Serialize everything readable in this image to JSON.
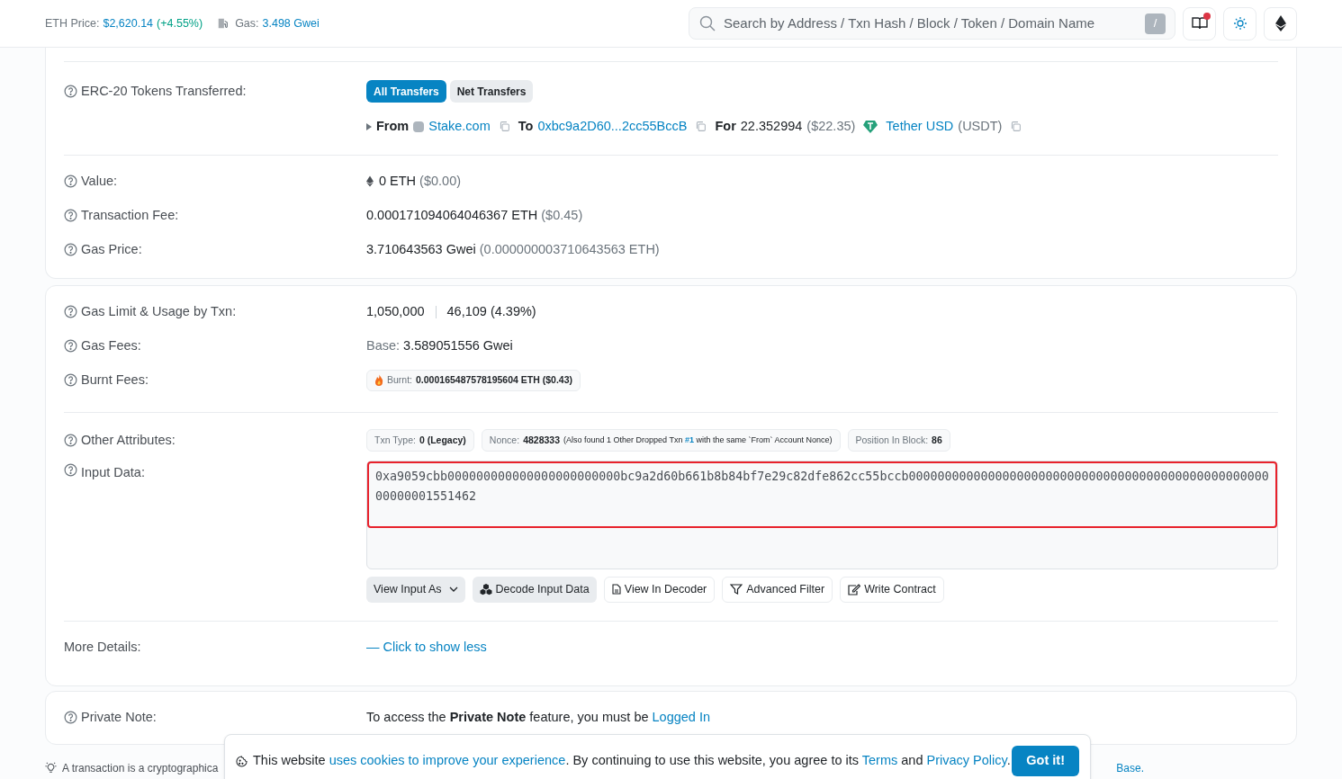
{
  "header": {
    "eth_price_label": "ETH Price:",
    "eth_price": "$2,620.14",
    "eth_change": "(+4.55%)",
    "gas_label": "Gas:",
    "gas_value": "3.498 Gwei",
    "search": {
      "placeholder": "Search by Address / Txn Hash / Block / Token / Domain Name",
      "shortcut": "/"
    },
    "notification": true
  },
  "tokens_row": {
    "label": "ERC-20 Tokens Transferred:",
    "tabs": [
      {
        "label": "All Transfers",
        "selected": true
      },
      {
        "label": "Net Transfers",
        "selected": false
      }
    ],
    "transfer": {
      "from_label": "From",
      "from": "Stake.com",
      "to_label": "To",
      "to": "0xbc9a2D60...2cc55BccB",
      "for_label": "For",
      "amount": "22.352994",
      "usd": "($22.35)",
      "token": "Tether USD",
      "symbol": "(USDT)"
    }
  },
  "summary_rows": [
    {
      "label": "Value:",
      "value": "0 ETH",
      "extra": "($0.00)",
      "kind": "eth"
    },
    {
      "label": "Transaction Fee:",
      "value": "0.000171094064046367 ETH",
      "extra": "($0.45)",
      "kind": "plain"
    },
    {
      "label": "Gas Price:",
      "value": "3.710643563 Gwei",
      "extra": "(0.000000003710643563 ETH)",
      "kind": "plain"
    }
  ],
  "gas_rows": [
    {
      "label": "Gas Limit & Usage by Txn:",
      "limit": "1,050,000",
      "usage": "46,109 (4.39%)"
    },
    {
      "label": "Gas Fees:",
      "base_label": "Base:",
      "base": "3.589051556 Gwei"
    },
    {
      "label": "Burnt Fees:",
      "burnt_label": "Burnt:",
      "burnt": "0.000165487578195604 ETH ($0.43)"
    }
  ],
  "other_attributes": {
    "label": "Other Attributes:",
    "badges": [
      {
        "key": "Txn Type:",
        "value": "0 (Legacy)"
      },
      {
        "key": "Nonce:",
        "value": "4828333",
        "note_before": "(Also found 1 Other Dropped Txn",
        "link": "#1",
        "note_after": "with the same `From` Account Nonce)"
      },
      {
        "key": "Position In Block:",
        "value": "86"
      }
    ]
  },
  "input_data": {
    "label": "Input Data:",
    "value": "0xa9059cbb000000000000000000000000bc9a2d60b661b8b84bf7e29c82dfe862cc55bccb0000000000000000000000000000000000000000000000000000000001551462",
    "highlighted": true,
    "buttons": [
      {
        "label": "View Input As",
        "kind": "dropdown"
      },
      {
        "label": "Decode Input Data",
        "kind": "decode"
      },
      {
        "label": "View In Decoder",
        "kind": "file"
      },
      {
        "label": "Advanced Filter",
        "kind": "filter"
      },
      {
        "label": "Write Contract",
        "kind": "edit"
      }
    ]
  },
  "more_details": {
    "label": "More Details:",
    "link": "— Click to show less"
  },
  "private_note": {
    "label": "Private Note:",
    "text": "To access the **Private Note** feature, you must be",
    "link": "Logged In"
  },
  "footer": {
    "left": "A transaction is a cryptographica",
    "right": "Base."
  },
  "cookie_banner": {
    "before": "This website",
    "link1": "uses cookies to improve your experience",
    "middle": ". By continuing to use this website, you agree to its",
    "link2": "Terms",
    "and": "and",
    "link3": "Privacy Policy",
    "end": ".",
    "button": "Got it!"
  }
}
